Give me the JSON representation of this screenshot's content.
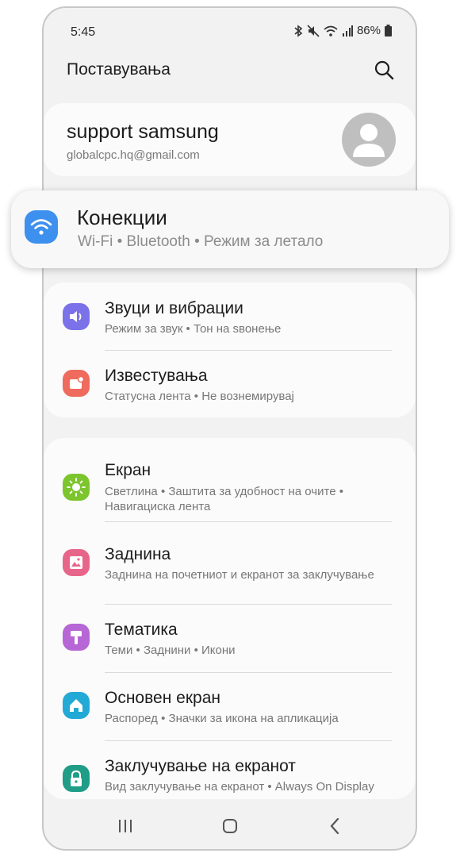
{
  "status_bar": {
    "time": "5:45",
    "battery": "86%",
    "icons": [
      "bluetooth-icon",
      "mute-icon",
      "wifi-icon",
      "signal-icon",
      "battery-icon"
    ]
  },
  "app_bar": {
    "title": "Поставувања",
    "search_icon": "search-icon"
  },
  "profile": {
    "name": "support samsung",
    "email": "globalcpc.hq@gmail.com",
    "avatar_icon": "person-icon"
  },
  "connections": {
    "title": "Конекции",
    "subtitle": "Wi-Fi  •  Bluetooth  •  Режим за летало",
    "icon": "wifi-icon",
    "icon_color": "#3d90ee"
  },
  "group1": [
    {
      "title": "Звуци и вибрации",
      "subtitle": "Режим за звук  •  Тон на ѕвонење",
      "icon": "speaker-icon",
      "color": "#7b72e9"
    },
    {
      "title": "Известувања",
      "subtitle": "Статусна лента  •  Не вознемирувај",
      "icon": "notification-icon",
      "color": "#ee6b5e"
    }
  ],
  "group2": [
    {
      "title": "Екран",
      "subtitle": "Светлина  •  Заштита за удобност на очите  •  Навигациска лента",
      "icon": "sun-icon",
      "color": "#7cc52d"
    },
    {
      "title": "Заднина",
      "subtitle": "Заднина на почетниот и екранот за заклучување",
      "icon": "image-icon",
      "color": "#e8658a"
    },
    {
      "title": "Тематика",
      "subtitle": "Теми  •  Заднини  •  Икони",
      "icon": "brush-icon",
      "color": "#b766d6"
    },
    {
      "title": "Основен екран",
      "subtitle": "Распоред  •  Значки за икона на апликација",
      "icon": "home-icon",
      "color": "#22a9d6"
    },
    {
      "title": "Заклучување на екранот",
      "subtitle": "Вид заклучување на екранот  •  Always On Display",
      "icon": "lock-icon",
      "color": "#1f9d86"
    }
  ],
  "nav_bar": {
    "buttons": [
      "recents-icon",
      "home-button-icon",
      "back-icon"
    ]
  }
}
